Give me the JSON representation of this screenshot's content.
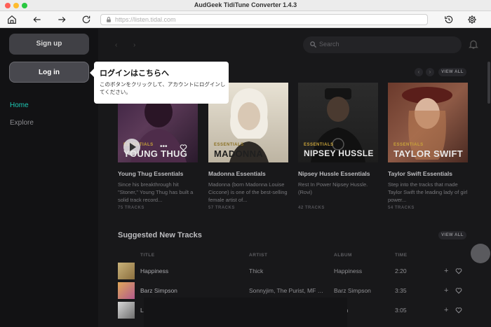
{
  "window": {
    "title": "AudGeek TidiTune Converter 1.4.3"
  },
  "toolbar": {
    "url": "https://listen.tidal.com"
  },
  "sidebar": {
    "signup_label": "Sign up",
    "login_label": "Log in",
    "items": [
      {
        "label": "Home",
        "active": true
      },
      {
        "label": "Explore",
        "active": false
      }
    ]
  },
  "header": {
    "search_placeholder": "Search"
  },
  "view_all_label": "VIEW ALL",
  "tooltip": {
    "title": "ログインはこちらへ",
    "body": "このボタンをクリックして、アカウントにログインしてください。"
  },
  "cards": [
    {
      "essentials": "ESSENTIALS",
      "artist": "YOUNG THUG",
      "title": "Young Thug Essentials",
      "desc": "Since his breakthrough hit \"Stoner,\" Young Thug has built a solid track record...",
      "count": "75 TRACKS"
    },
    {
      "essentials": "ESSENTIALS",
      "artist": "MADONNA",
      "title": "Madonna Essentials",
      "desc": "Madonna (born Madonna Louise Ciccone) is one of the best-selling female artist of...",
      "count": "57 TRACKS"
    },
    {
      "essentials": "ESSENTIALS",
      "artist": "NIPSEY HUSSLE",
      "title": "Nipsey Hussle Essentials",
      "desc": "Rest In Power Nipsey Hussle. (Rovi)",
      "count": "42 TRACKS"
    },
    {
      "essentials": "ESSENTIALS",
      "artist": "TAYLOR SWIFT",
      "title": "Taylor Swift Essentials",
      "desc": "Step into the tracks that made Taylor Swift the leading lady of girl power...",
      "count": "54 TRACKS"
    }
  ],
  "suggested": {
    "title": "Suggested New Tracks",
    "columns": {
      "title": "TITLE",
      "artist": "ARTIST",
      "album": "ALBUM",
      "time": "TIME"
    },
    "tracks": [
      {
        "name": "Happiness",
        "artist": "Thick",
        "album": "Happiness",
        "time": "2:20"
      },
      {
        "name": "Barz Simpson",
        "artist": "Sonnyjim, The Purist, MF DOOM",
        "album": "Barz Simpson",
        "time": "3:35"
      },
      {
        "name": "L",
        "artist": "",
        "album": "given",
        "time": "3:05"
      }
    ]
  },
  "colors": {
    "accent": "#1ec8b4",
    "background": "#18181a",
    "sidebar": "#121214"
  }
}
